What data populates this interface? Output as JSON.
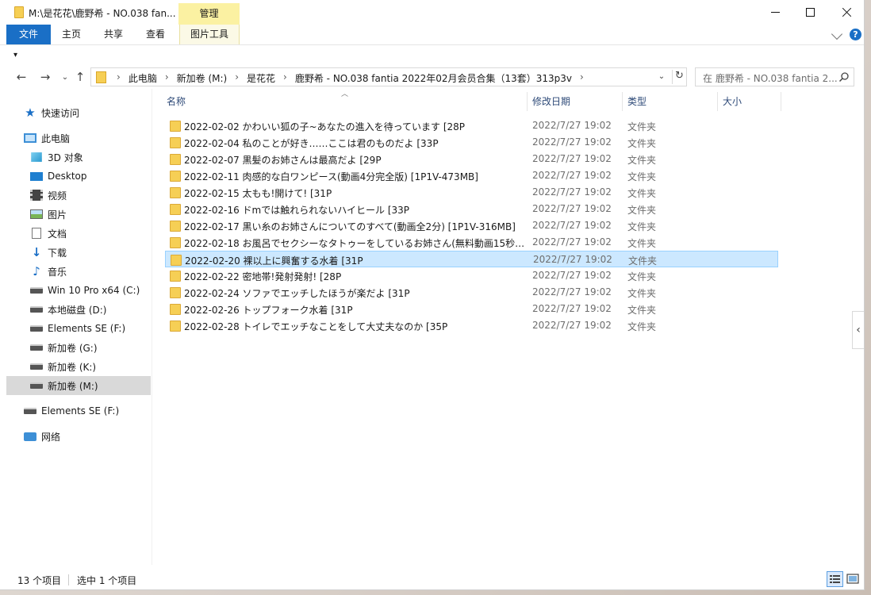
{
  "window": {
    "title": "M:\\是花花\\鹿野希 - NO.038 fan...",
    "manage_tab": "管理"
  },
  "ribbon": {
    "tabs": [
      "文件",
      "主页",
      "共享",
      "查看",
      "图片工具"
    ]
  },
  "address": {
    "crumbs": [
      "此电脑",
      "新加卷 (M:)",
      "是花花",
      "鹿野希 - NO.038 fantia 2022年02月会员合集（13套）313p3v"
    ]
  },
  "search": {
    "placeholder": "在 鹿野希 - NO.038 fantia 2..."
  },
  "sidebar": {
    "items": [
      {
        "label": "快速访问",
        "icon": "star-icon"
      },
      {
        "label": "此电脑",
        "icon": "pc-icon"
      },
      {
        "label": "3D 对象",
        "icon": "cube-icon"
      },
      {
        "label": "Desktop",
        "icon": "desktop-icon"
      },
      {
        "label": "视频",
        "icon": "video-icon"
      },
      {
        "label": "图片",
        "icon": "picture-icon"
      },
      {
        "label": "文档",
        "icon": "document-icon"
      },
      {
        "label": "下载",
        "icon": "download-icon"
      },
      {
        "label": "音乐",
        "icon": "music-icon"
      },
      {
        "label": "Win 10 Pro x64 (C:)",
        "icon": "drive-icon"
      },
      {
        "label": "本地磁盘 (D:)",
        "icon": "drive-icon"
      },
      {
        "label": "Elements SE (F:)",
        "icon": "drive-icon"
      },
      {
        "label": "新加卷 (G:)",
        "icon": "drive-icon"
      },
      {
        "label": "新加卷 (K:)",
        "icon": "drive-icon"
      },
      {
        "label": "新加卷 (M:)",
        "icon": "drive-icon"
      },
      {
        "label": "Elements SE (F:)",
        "icon": "drive-icon"
      },
      {
        "label": "网络",
        "icon": "network-icon"
      }
    ]
  },
  "columns": {
    "name": "名称",
    "date": "修改日期",
    "type": "类型",
    "size": "大小"
  },
  "files": [
    {
      "name": "2022-02-02 かわいい狐の子~あなたの進入を待っています [28P",
      "date": "2022/7/27 19:02",
      "type": "文件夹"
    },
    {
      "name": "2022-02-04 私のことが好き……ここは君のものだよ [33P",
      "date": "2022/7/27 19:02",
      "type": "文件夹"
    },
    {
      "name": "2022-02-07 黒髪のお姉さんは最高だよ [29P",
      "date": "2022/7/27 19:02",
      "type": "文件夹"
    },
    {
      "name": "2022-02-11 肉感的な白ワンピース(動画4分完全版) [1P1V-473MB]",
      "date": "2022/7/27 19:02",
      "type": "文件夹"
    },
    {
      "name": "2022-02-15 太もも!開けて! [31P",
      "date": "2022/7/27 19:02",
      "type": "文件夹"
    },
    {
      "name": "2022-02-16 ドmでは触れられないハイヒール [33P",
      "date": "2022/7/27 19:02",
      "type": "文件夹"
    },
    {
      "name": "2022-02-17 黒い糸のお姉さんについてのすべて(動画全2分) [1P1V-316MB]",
      "date": "2022/7/27 19:02",
      "type": "文件夹"
    },
    {
      "name": "2022-02-18 お風呂でセクシーなタトゥーをしているお姉さん(無料動画15秒)...",
      "date": "2022/7/27 19:02",
      "type": "文件夹"
    },
    {
      "name": "2022-02-20 裸以上に興奮する水着 [31P",
      "date": "2022/7/27 19:02",
      "type": "文件夹"
    },
    {
      "name": "2022-02-22 密地帯!発射発射! [28P",
      "date": "2022/7/27 19:02",
      "type": "文件夹"
    },
    {
      "name": "2022-02-24 ソファでエッチしたほうが楽だよ [31P",
      "date": "2022/7/27 19:02",
      "type": "文件夹"
    },
    {
      "name": "2022-02-26 トップフォーク水着 [31P",
      "date": "2022/7/27 19:02",
      "type": "文件夹"
    },
    {
      "name": "2022-02-28 トイレでエッチなことをして大丈夫なのか [35P",
      "date": "2022/7/27 19:02",
      "type": "文件夹"
    }
  ],
  "status": {
    "count": "13 个项目",
    "selected": "选中 1 个项目"
  },
  "colors": {
    "accent": "#1a6fc6",
    "selection": "#cce8ff",
    "folder": "#f6cf55",
    "manage_tab": "#fbf1a2"
  }
}
